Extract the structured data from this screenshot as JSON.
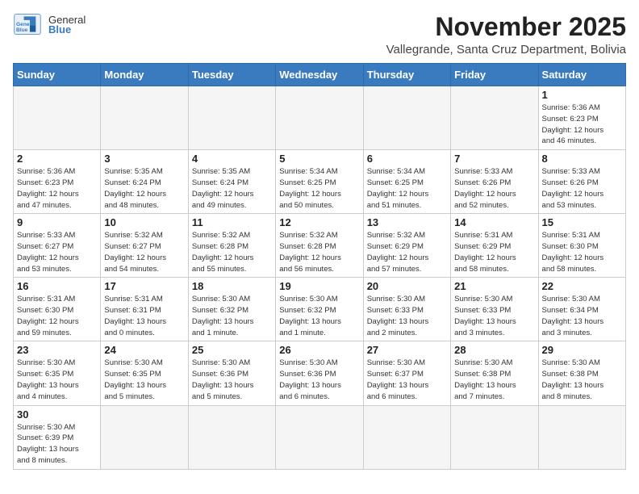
{
  "header": {
    "logo_text_normal": "General",
    "logo_text_bold": "Blue",
    "month_title": "November 2025",
    "location": "Vallegrande, Santa Cruz Department, Bolivia"
  },
  "weekdays": [
    "Sunday",
    "Monday",
    "Tuesday",
    "Wednesday",
    "Thursday",
    "Friday",
    "Saturday"
  ],
  "days": {
    "d1": {
      "num": "1",
      "info": "Sunrise: 5:36 AM\nSunset: 6:23 PM\nDaylight: 12 hours\nand 46 minutes."
    },
    "d2": {
      "num": "2",
      "info": "Sunrise: 5:36 AM\nSunset: 6:23 PM\nDaylight: 12 hours\nand 47 minutes."
    },
    "d3": {
      "num": "3",
      "info": "Sunrise: 5:35 AM\nSunset: 6:24 PM\nDaylight: 12 hours\nand 48 minutes."
    },
    "d4": {
      "num": "4",
      "info": "Sunrise: 5:35 AM\nSunset: 6:24 PM\nDaylight: 12 hours\nand 49 minutes."
    },
    "d5": {
      "num": "5",
      "info": "Sunrise: 5:34 AM\nSunset: 6:25 PM\nDaylight: 12 hours\nand 50 minutes."
    },
    "d6": {
      "num": "6",
      "info": "Sunrise: 5:34 AM\nSunset: 6:25 PM\nDaylight: 12 hours\nand 51 minutes."
    },
    "d7": {
      "num": "7",
      "info": "Sunrise: 5:33 AM\nSunset: 6:26 PM\nDaylight: 12 hours\nand 52 minutes."
    },
    "d8": {
      "num": "8",
      "info": "Sunrise: 5:33 AM\nSunset: 6:26 PM\nDaylight: 12 hours\nand 53 minutes."
    },
    "d9": {
      "num": "9",
      "info": "Sunrise: 5:33 AM\nSunset: 6:27 PM\nDaylight: 12 hours\nand 53 minutes."
    },
    "d10": {
      "num": "10",
      "info": "Sunrise: 5:32 AM\nSunset: 6:27 PM\nDaylight: 12 hours\nand 54 minutes."
    },
    "d11": {
      "num": "11",
      "info": "Sunrise: 5:32 AM\nSunset: 6:28 PM\nDaylight: 12 hours\nand 55 minutes."
    },
    "d12": {
      "num": "12",
      "info": "Sunrise: 5:32 AM\nSunset: 6:28 PM\nDaylight: 12 hours\nand 56 minutes."
    },
    "d13": {
      "num": "13",
      "info": "Sunrise: 5:32 AM\nSunset: 6:29 PM\nDaylight: 12 hours\nand 57 minutes."
    },
    "d14": {
      "num": "14",
      "info": "Sunrise: 5:31 AM\nSunset: 6:29 PM\nDaylight: 12 hours\nand 58 minutes."
    },
    "d15": {
      "num": "15",
      "info": "Sunrise: 5:31 AM\nSunset: 6:30 PM\nDaylight: 12 hours\nand 58 minutes."
    },
    "d16": {
      "num": "16",
      "info": "Sunrise: 5:31 AM\nSunset: 6:30 PM\nDaylight: 12 hours\nand 59 minutes."
    },
    "d17": {
      "num": "17",
      "info": "Sunrise: 5:31 AM\nSunset: 6:31 PM\nDaylight: 13 hours\nand 0 minutes."
    },
    "d18": {
      "num": "18",
      "info": "Sunrise: 5:30 AM\nSunset: 6:32 PM\nDaylight: 13 hours\nand 1 minute."
    },
    "d19": {
      "num": "19",
      "info": "Sunrise: 5:30 AM\nSunset: 6:32 PM\nDaylight: 13 hours\nand 1 minute."
    },
    "d20": {
      "num": "20",
      "info": "Sunrise: 5:30 AM\nSunset: 6:33 PM\nDaylight: 13 hours\nand 2 minutes."
    },
    "d21": {
      "num": "21",
      "info": "Sunrise: 5:30 AM\nSunset: 6:33 PM\nDaylight: 13 hours\nand 3 minutes."
    },
    "d22": {
      "num": "22",
      "info": "Sunrise: 5:30 AM\nSunset: 6:34 PM\nDaylight: 13 hours\nand 3 minutes."
    },
    "d23": {
      "num": "23",
      "info": "Sunrise: 5:30 AM\nSunset: 6:35 PM\nDaylight: 13 hours\nand 4 minutes."
    },
    "d24": {
      "num": "24",
      "info": "Sunrise: 5:30 AM\nSunset: 6:35 PM\nDaylight: 13 hours\nand 5 minutes."
    },
    "d25": {
      "num": "25",
      "info": "Sunrise: 5:30 AM\nSunset: 6:36 PM\nDaylight: 13 hours\nand 5 minutes."
    },
    "d26": {
      "num": "26",
      "info": "Sunrise: 5:30 AM\nSunset: 6:36 PM\nDaylight: 13 hours\nand 6 minutes."
    },
    "d27": {
      "num": "27",
      "info": "Sunrise: 5:30 AM\nSunset: 6:37 PM\nDaylight: 13 hours\nand 6 minutes."
    },
    "d28": {
      "num": "28",
      "info": "Sunrise: 5:30 AM\nSunset: 6:38 PM\nDaylight: 13 hours\nand 7 minutes."
    },
    "d29": {
      "num": "29",
      "info": "Sunrise: 5:30 AM\nSunset: 6:38 PM\nDaylight: 13 hours\nand 8 minutes."
    },
    "d30": {
      "num": "30",
      "info": "Sunrise: 5:30 AM\nSunset: 6:39 PM\nDaylight: 13 hours\nand 8 minutes."
    }
  }
}
